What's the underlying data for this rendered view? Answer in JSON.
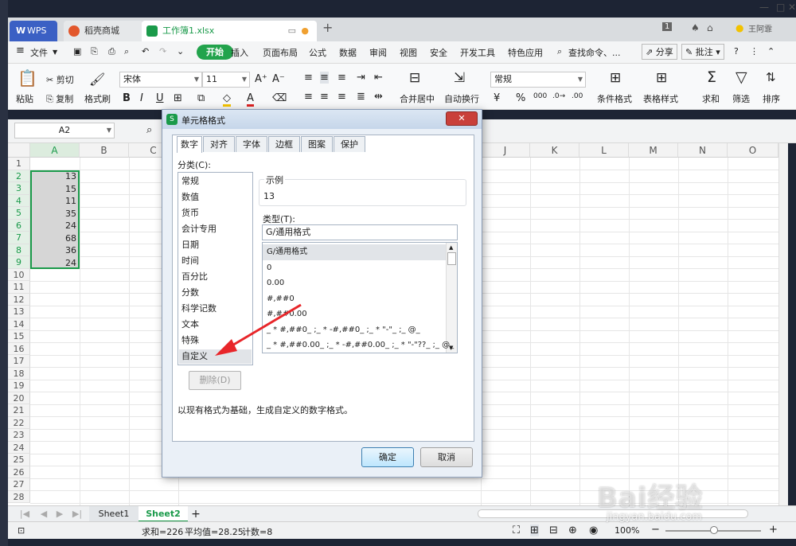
{
  "window": {
    "tabs": [
      {
        "label": "WPS"
      },
      {
        "label": "稻壳商城"
      },
      {
        "label": "工作簿1.xlsx"
      }
    ],
    "page_badge": "1",
    "user": "王阿霏"
  },
  "menu": {
    "file": "文件",
    "items": [
      "开始",
      "插入",
      "页面布局",
      "公式",
      "数据",
      "审阅",
      "视图",
      "安全",
      "开发工具",
      "特色应用"
    ],
    "search": "查找命令、...",
    "share": "分享",
    "comment": "批注"
  },
  "ribbon": {
    "paste": "粘贴",
    "cut": "剪切",
    "copy": "复制",
    "format_painter": "格式刷",
    "font": "宋体",
    "size": "11",
    "merge": "合并居中",
    "wrap": "自动换行",
    "numfmt": "常规",
    "cond": "条件格式",
    "tblstyle": "表格样式",
    "sum": "求和",
    "filter": "筛选",
    "sort": "排序"
  },
  "namebox": "A2",
  "sheet": {
    "columns": [
      "A",
      "B",
      "C",
      "J",
      "K",
      "L",
      "M",
      "N",
      "O"
    ],
    "rows": [
      "1",
      "2",
      "3",
      "4",
      "5",
      "6",
      "7",
      "8",
      "9",
      "10",
      "11",
      "12",
      "13",
      "14",
      "15",
      "16",
      "17",
      "18",
      "19",
      "20",
      "21",
      "22",
      "23",
      "24",
      "25",
      "26",
      "27",
      "28"
    ],
    "values": [
      "13",
      "15",
      "11",
      "35",
      "24",
      "68",
      "36",
      "24"
    ]
  },
  "sheets": [
    "Sheet1",
    "Sheet2"
  ],
  "status": {
    "sum": "求和=226",
    "avg": "平均值=28.25",
    "count": "计数=8",
    "zoom": "100%"
  },
  "dialog": {
    "title": "单元格格式",
    "tabs": [
      "数字",
      "对齐",
      "字体",
      "边框",
      "图案",
      "保护"
    ],
    "category_label": "分类(C):",
    "categories": [
      "常规",
      "数值",
      "货币",
      "会计专用",
      "日期",
      "时间",
      "百分比",
      "分数",
      "科学记数",
      "文本",
      "特殊",
      "自定义"
    ],
    "delete": "删除(D)",
    "sample_label": "示例",
    "sample_value": "13",
    "type_label": "类型(T):",
    "type_value": "G/通用格式",
    "types": [
      "G/通用格式",
      "0",
      "0.00",
      "#,##0",
      "#,##0.00",
      "_ * #,##0_ ;_ * -#,##0_ ;_ * \"-\"_ ;_ @_",
      "_ * #,##0.00_ ;_ * -#,##0.00_ ;_ * \"-\"??_ ;_ @_"
    ],
    "description": "以现有格式为基础，生成自定义的数字格式。",
    "ok": "确定",
    "cancel": "取消"
  },
  "watermark": {
    "brand": "Bai经验",
    "url": "jingyan.baidu.com"
  }
}
